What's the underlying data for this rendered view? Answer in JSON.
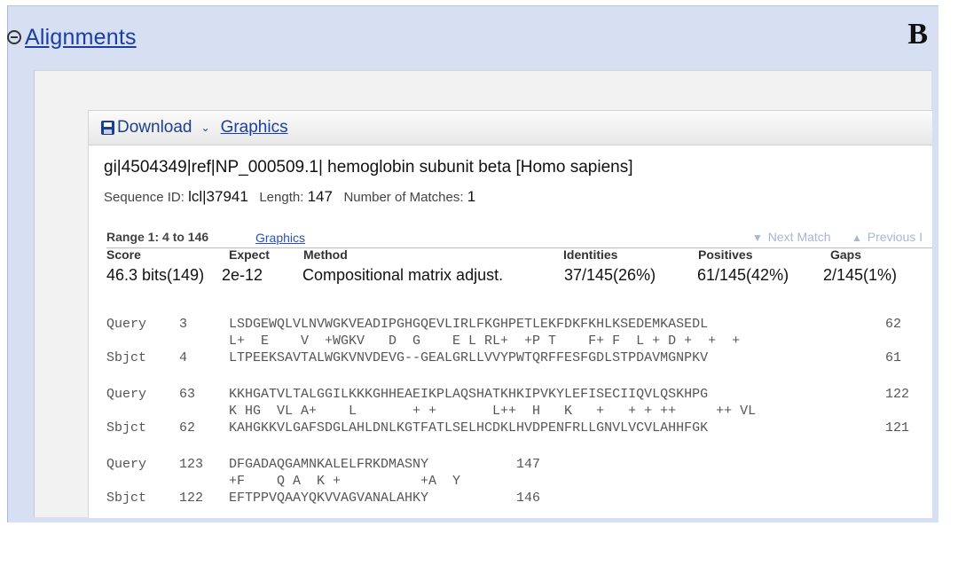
{
  "section": {
    "title": "Alignments",
    "panel_letter": "B"
  },
  "toolbar": {
    "download_label": "Download",
    "graphics_label": "Graphics"
  },
  "hit": {
    "title": "gi|4504349|ref|NP_000509.1| hemoglobin subunit beta [Homo sapiens]",
    "seq_id_label": "Sequence ID:",
    "seq_id": "lcl|37941",
    "length_label": "Length:",
    "length": "147",
    "matches_label": "Number of Matches:",
    "matches": "1"
  },
  "range": {
    "label": "Range 1: 4 to 146",
    "graphics_link": "Graphics",
    "next_match": "Next Match",
    "previous_match": "Previous I"
  },
  "stats": {
    "headers": [
      "Score",
      "Expect",
      "Method",
      "Identities",
      "Positives",
      "Gaps"
    ],
    "values": [
      "46.3 bits(149)",
      "2e-12",
      "Compositional matrix adjust.",
      "37/145(26%)",
      "61/145(42%)",
      "2/145(1%)"
    ]
  },
  "alignment_blocks": [
    {
      "query": {
        "label": "Query",
        "start": "3",
        "seq": "LSDGEWQLVLNVWGKVEADIPGHGQEVLIRLFKGHPETLEKFDKFKHLKSEDEMKASEDL",
        "end": "62"
      },
      "midline": "L+  E    V  +WGKV   D  G    E L RL+  +P T    F+ F  L + D +  +  +",
      "sbjct": {
        "label": "Sbjct",
        "start": "4",
        "seq": "LTPEEKSAVTALWGKVNVDEVG--GEALGRLLVVYPWTQRFFESFGDLSTPDAVMGNPKV",
        "end": "61"
      }
    },
    {
      "query": {
        "label": "Query",
        "start": "63",
        "seq": "KKHGATVLTALGGILKKKGHHEAEIKPLAQSHATKHKIPVKYLEFISECIIQVLQSKHPG",
        "end": "122"
      },
      "midline": "K HG  VL A+    L       + +       L++  H   K   +   + + ++     ++ VL",
      "sbjct": {
        "label": "Sbjct",
        "start": "62",
        "seq": "KAHGKKVLGAFSDGLAHLDNLKGTFATLSELHCDKLHVDPENFRLLGNVLVCVLAHHFGK",
        "end": "121"
      }
    },
    {
      "query": {
        "label": "Query",
        "start": "123",
        "seq": "DFGADAQGAMNKALELFRKDMASNY",
        "end": "147"
      },
      "midline": "+F    Q A  K +          +A  Y",
      "sbjct": {
        "label": "Sbjct",
        "start": "122",
        "seq": "EFTPPVQAAYQKVVAGVANALAHKY",
        "end": "146"
      }
    }
  ]
}
